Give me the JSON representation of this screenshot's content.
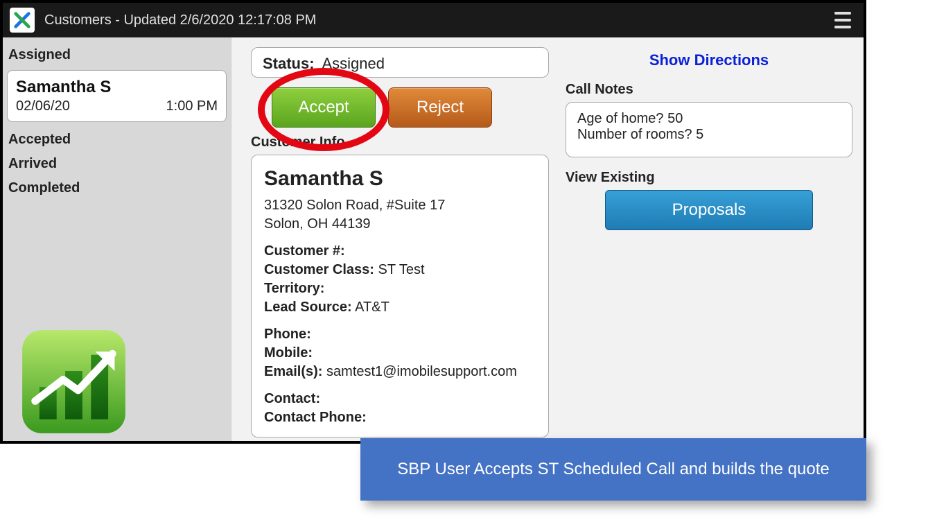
{
  "header": {
    "title": "Customers - Updated 2/6/2020 12:17:08 PM"
  },
  "sidebar": {
    "cat_assigned": "Assigned",
    "cat_accepted": "Accepted",
    "cat_arrived": "Arrived",
    "cat_completed": "Completed",
    "card": {
      "name": "Samantha S",
      "date": "02/06/20",
      "time": "1:00 PM"
    }
  },
  "status": {
    "label": "Status:",
    "value": "Assigned"
  },
  "buttons": {
    "accept": "Accept",
    "reject": "Reject"
  },
  "customer_info": {
    "section_title": "Customer Info",
    "name": "Samantha S",
    "address_line1": "31320 Solon Road, #Suite 17",
    "address_line2": "Solon, OH 44139",
    "labels": {
      "customer_num": "Customer #:",
      "customer_class": "Customer Class:",
      "territory": "Territory:",
      "lead_source": "Lead Source:",
      "phone": "Phone:",
      "mobile": "Mobile:",
      "emails": "Email(s):",
      "contact": "Contact:",
      "contact_phone": "Contact Phone:"
    },
    "values": {
      "customer_num": "",
      "customer_class": "ST Test",
      "territory": "",
      "lead_source": "AT&T",
      "phone": "",
      "mobile": "",
      "emails": "samtest1@imobilesupport.com",
      "contact": "",
      "contact_phone": ""
    }
  },
  "right": {
    "show_directions": "Show Directions",
    "call_notes_title": "Call Notes",
    "call_notes": "Age of home? 50\nNumber of rooms? 5",
    "view_existing_title": "View Existing",
    "proposals": "Proposals"
  },
  "caption": "SBP User Accepts ST  Scheduled Call and builds the quote"
}
